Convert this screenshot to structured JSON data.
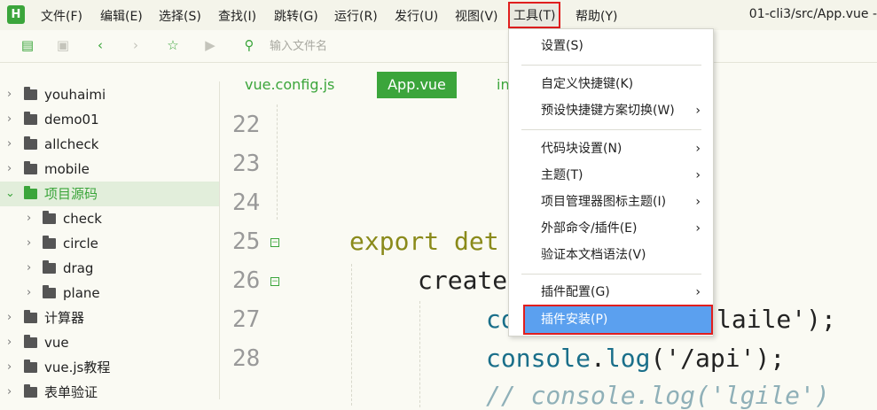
{
  "menubar": {
    "logo": "H",
    "items": [
      "文件(F)",
      "编辑(E)",
      "选择(S)",
      "查找(I)",
      "跳转(G)",
      "运行(R)",
      "发行(U)",
      "视图(V)",
      "工具(T)",
      "帮助(Y)"
    ],
    "window_title": "01-cli3/src/App.vue -"
  },
  "toolbar": {
    "icons": [
      "new-file-icon",
      "save-icon",
      "back-icon",
      "forward-icon",
      "star-icon",
      "run-icon",
      "file-search-icon"
    ],
    "search_placeholder": "输入文件名"
  },
  "sidebar": {
    "items": [
      {
        "label": "youhaimi"
      },
      {
        "label": "demo01"
      },
      {
        "label": "allcheck"
      },
      {
        "label": "mobile"
      },
      {
        "label": "项目源码"
      },
      {
        "label": "check"
      },
      {
        "label": "circle"
      },
      {
        "label": "drag"
      },
      {
        "label": "plane"
      },
      {
        "label": "计算器"
      },
      {
        "label": "vue"
      },
      {
        "label": "vue.js教程"
      },
      {
        "label": "表单验证"
      }
    ]
  },
  "tabs": [
    "vue.config.js",
    "App.vue",
    "in"
  ],
  "editor": {
    "line_numbers": [
      "22",
      "23",
      "24",
      "25",
      "26",
      "27",
      "28"
    ],
    "code": {
      "l25_kw": "export",
      "l25_rest": " det",
      "l26": "create",
      "l27_a": "co",
      "l27_b": "laile');",
      "l28_obj": "console",
      "l28_dot": ".",
      "l28_fn": "log",
      "l28_rest": "('/api');",
      "l29": "// console.log('lgile')"
    }
  },
  "tools_menu": {
    "items": [
      {
        "label": "设置(S)"
      },
      {
        "label": "自定义快捷键(K)"
      },
      {
        "label": "预设快捷键方案切换(W)"
      },
      {
        "label": "代码块设置(N)"
      },
      {
        "label": "主题(T)"
      },
      {
        "label": "项目管理器图标主题(I)"
      },
      {
        "label": "外部命令/插件(E)"
      },
      {
        "label": "验证本文档语法(V)"
      },
      {
        "label": "插件配置(G)"
      },
      {
        "label": "插件安装(P)"
      }
    ]
  },
  "colors": {
    "accent": "#3ba53b",
    "highlight": "#5ba0ef",
    "callout": "#e01e1e"
  }
}
